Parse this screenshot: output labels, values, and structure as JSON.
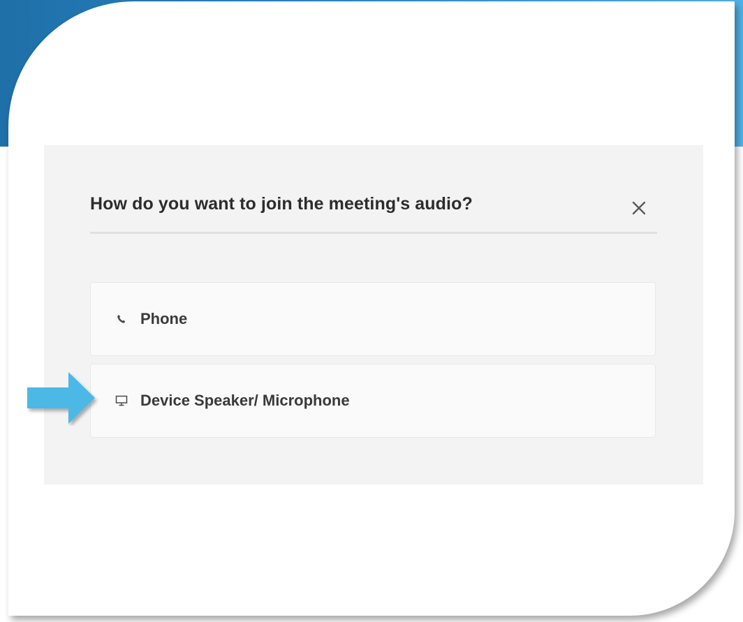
{
  "dialog": {
    "title": "How do you want to join the meeting's audio?",
    "close_icon": "close-icon",
    "options": [
      {
        "label": "Phone",
        "icon": "phone-icon"
      },
      {
        "label": "Device Speaker/ Microphone",
        "icon": "monitor-icon"
      }
    ]
  },
  "annotation": {
    "arrow_icon": "pointer-arrow-icon",
    "arrow_color": "#4bb8e6"
  },
  "colors": {
    "backdrop_start": "#1f6fa8",
    "backdrop_end": "#4fb2e6",
    "dialog_bg": "#f3f3f3",
    "option_bg": "#fafafa",
    "title_text": "#2c2c2c"
  }
}
